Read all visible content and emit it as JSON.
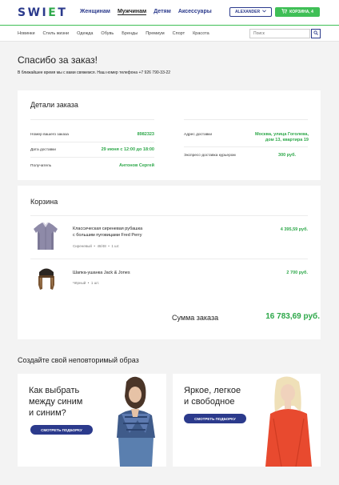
{
  "header": {
    "logo_main": "SWI",
    "logo_accent": "E",
    "logo_end": "T",
    "nav": [
      "Женщинам",
      "Мужчинам",
      "Детям",
      "Аксессуары"
    ],
    "active_nav": "Мужчинам",
    "user_label": "ALEXANDER",
    "cart_label": "КОРЗИНА, 4"
  },
  "subnav": [
    "Новинки",
    "Стиль жизни",
    "Одежда",
    "Обувь",
    "Бренды",
    "Премиум",
    "Спорт",
    "Красота"
  ],
  "search": {
    "placeholder": "Поиск"
  },
  "confirmation": {
    "title": "Спасибо за заказ!",
    "subtitle": "В ближайшее время мы с вами свяжемся. Наш номер телефона +7 926 790-33-22"
  },
  "order_details": {
    "title": "Детали заказа",
    "left": [
      {
        "label": "Номер вашего заказа",
        "value": "8982323"
      },
      {
        "label": "Дата доставки",
        "value": "29 июня с 12:00 до 18:00"
      },
      {
        "label": "Получатель",
        "value": "Антонов Сергей"
      }
    ],
    "right": [
      {
        "label": "Адрес доставки",
        "value_line1": "Москва, улица Гоголева,",
        "value_line2": "дом 13, квартира 19"
      },
      {
        "label": "Экспресс-доставка курьером",
        "value_line1": "300 руб.",
        "value_line2": ""
      }
    ]
  },
  "cart": {
    "title": "Корзина",
    "items": [
      {
        "name_line1": "Классическая сиреневая рубашка",
        "name_line2": "с большим пуговицами Fred Perry",
        "color": "Сиреневый",
        "size": "48/48",
        "qty": "1 шт.",
        "price": "4 395,59 руб."
      },
      {
        "name_line1": "Шапка-ушанка Jack & Jones",
        "name_line2": "",
        "color": "Чёрный",
        "size": "",
        "qty": "1 шт.",
        "price": "2 700 руб."
      }
    ],
    "total_label": "Сумма заказа",
    "total_value": "16 783,69 руб."
  },
  "promos": {
    "heading": "Создайте свой неповторимый образ",
    "items": [
      {
        "line1": "Как выбрать",
        "line2": "между синим",
        "line3": "и синим?",
        "button": "СМОТРЕТЬ ПОДБОРКУ"
      },
      {
        "line1": "Яркое, легкое",
        "line2": "и свободное",
        "line3": "",
        "button": "СМОТРЕТЬ ПОДБОРКУ"
      }
    ]
  },
  "colors": {
    "brand_blue": "#2b3a8c",
    "accent_green": "#3fbf56",
    "price_green": "#2ea84a"
  }
}
